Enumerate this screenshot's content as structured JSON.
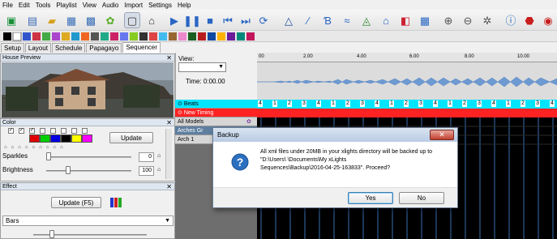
{
  "menu": [
    "File",
    "Edit",
    "Tools",
    "Playlist",
    "View",
    "Audio",
    "Import",
    "Settings",
    "Help"
  ],
  "tabs": [
    "Setup",
    "Layout",
    "Schedule",
    "Papagayo",
    "Sequencer"
  ],
  "active_tab": "Sequencer",
  "house_preview": {
    "title": "House Preview"
  },
  "color_panel": {
    "title": "Color",
    "update_label": "Update",
    "palette": [
      "#e00000",
      "#00d000",
      "#0000e0",
      "#000000",
      "#ffff00",
      "#ff00ff"
    ],
    "sparkles_label": "Sparkles",
    "sparkles_value": "0",
    "brightness_label": "Brightness",
    "brightness_value": "100"
  },
  "effect_panel": {
    "title": "Effect",
    "update_label": "Update (F5)",
    "effect_value": "Bars"
  },
  "sequencer": {
    "view_label": "View:",
    "view_value": "",
    "time_label": "Time: 0:00.00",
    "timeline_ticks": [
      "00",
      "2.00",
      "4.00",
      "6.00",
      "8.00",
      "10.00"
    ],
    "rows": [
      {
        "label": "Beats",
        "color": "#00e5ff"
      },
      {
        "label": "New Timing",
        "color": "#ff2222"
      },
      {
        "label": "All Models",
        "color": "#d6d6d6"
      },
      {
        "label": "Arches Gr",
        "color": "#5f7fa0"
      },
      {
        "label": "Arch 1",
        "color": "#d6d6d6"
      }
    ],
    "beat_labels": [
      "4",
      "1",
      "2",
      "3",
      "4",
      "1",
      "2",
      "3",
      "4",
      "1",
      "2",
      "3",
      "4",
      "1",
      "2",
      "3",
      "4",
      "1",
      "2",
      "3",
      "4"
    ]
  },
  "dialog": {
    "title": "Backup",
    "message_line1": "All xml files under 20MB in your xlights directory will be backed up to",
    "message_line2": "\"D:\\Users\\            \\Documents\\My xLights",
    "message_line3": "Sequences\\Backup\\2016-04-25-163833\". Proceed?",
    "yes_label": "Yes",
    "no_label": "No",
    "close_label": "✕"
  }
}
